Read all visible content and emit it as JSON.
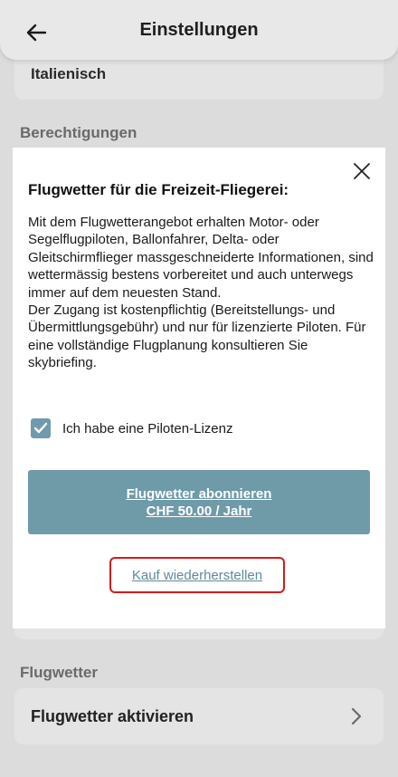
{
  "header": {
    "title": "Einstellungen",
    "back_icon": "arrow-left-icon"
  },
  "language": {
    "value": "Italienisch"
  },
  "sections": {
    "permissions": "Berechtigungen",
    "flight_weather": "Flugwetter"
  },
  "flight_weather_row": {
    "label": "Flugwetter aktivieren",
    "icon": "chevron-right-icon"
  },
  "dialog": {
    "title": "Flugwetter für die Freizeit-Fliegerei:",
    "paragraph_1": "Mit dem Flugwetterangebot erhalten Motor- oder Segelflugpiloten, Ballonfahrer, Delta- oder Gleitschirmflieger massgeschneiderte Informationen, sind wettermässig bestens vorbereitet und auch unterwegs immer auf dem neuesten Stand.",
    "paragraph_2": "Der Zugang ist kostenpflichtig (Bereitstellungs- und Übermittlungsgebühr) und nur für lizenzierte Piloten. Für eine vollständige Flugplanung konsultieren Sie skybriefing.",
    "license_checkbox_label": "Ich habe eine Piloten-Lizenz",
    "license_checked": true,
    "subscribe_line_1": "Flugwetter abonnieren",
    "subscribe_line_2": "CHF 50.00 / Jahr",
    "restore_label": "Kauf wiederherstellen",
    "close_icon": "close-icon"
  },
  "colors": {
    "accent": "#6f9aa8",
    "highlight_border": "#d21c1c",
    "link": "#5f8a98"
  }
}
